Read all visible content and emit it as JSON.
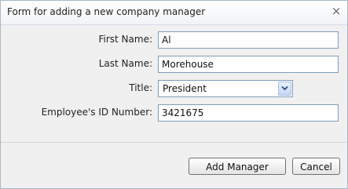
{
  "dialog": {
    "title": "Form for adding a new company manager",
    "close_glyph": "×"
  },
  "form": {
    "first_name": {
      "label": "First Name:",
      "value": "Al"
    },
    "last_name": {
      "label": "Last Name:",
      "value": "Morehouse"
    },
    "title": {
      "label": "Title:",
      "selected": "President"
    },
    "employee_id": {
      "label": "Employee's ID Number:",
      "value": "3421675"
    }
  },
  "buttons": {
    "add": "Add Manager",
    "cancel": "Cancel"
  },
  "icons": {
    "close": "close-icon",
    "dropdown": "chevron-down-icon"
  }
}
